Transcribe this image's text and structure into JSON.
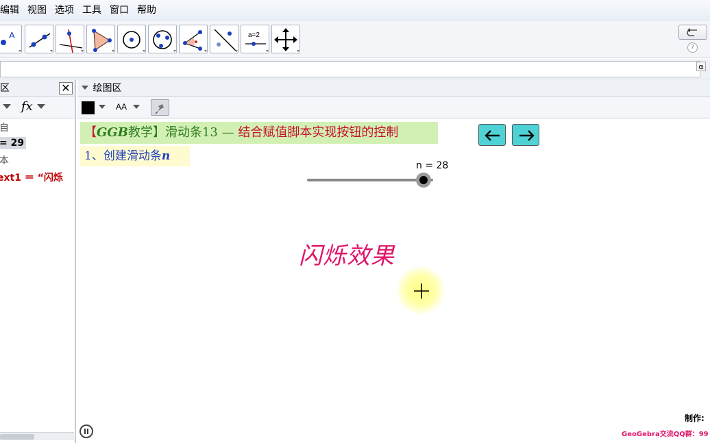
{
  "menu": [
    "编辑",
    "视图",
    "选项",
    "工具",
    "窗口",
    "帮助"
  ],
  "toolbar": {
    "tools": [
      {
        "name": "point-tool",
        "icon": "point-icon"
      },
      {
        "name": "line-tool",
        "icon": "line-icon"
      },
      {
        "name": "perpendicular-tool",
        "icon": "perpendicular-icon"
      },
      {
        "name": "polygon-tool",
        "icon": "polygon-icon"
      },
      {
        "name": "circle-tool",
        "icon": "circle-icon"
      },
      {
        "name": "conic-tool",
        "icon": "ellipse-icon"
      },
      {
        "name": "angle-tool",
        "icon": "angle-icon"
      },
      {
        "name": "reflect-tool",
        "icon": "reflect-icon"
      },
      {
        "name": "slider-tool",
        "icon": "slider-icon"
      },
      {
        "name": "move-view-tool",
        "icon": "move-graphics-icon"
      }
    ],
    "slider_tool_label": "a=2",
    "point_tool_label": "A",
    "help_label": "?"
  },
  "input_bar": {
    "value": "",
    "symbol_label": "α"
  },
  "algebra": {
    "title": "区",
    "close_label": "✕",
    "fx_label": "fx",
    "rows": [
      {
        "text": "自",
        "color": "#000000"
      },
      {
        "text": "= 29",
        "color": "#000000",
        "highlight": true
      },
      {
        "text": "本",
        "color": "#000000"
      },
      {
        "text": "ext1 ＝ “闪烁",
        "color": "#c00000"
      }
    ]
  },
  "graphics": {
    "title": "绘图区",
    "font_size_label": "AA",
    "title_box": {
      "prefix": "【",
      "brand": "GGB",
      "brand_suffix": "教学】",
      "subject": "滑动条13 ",
      "dash": "—",
      "topic": " 结合赋值脚本实现按钮的控制"
    },
    "step_label": "1、创建滑动条",
    "step_var": "n",
    "slider": {
      "label": "n = 28",
      "value": 28
    },
    "nav": {
      "prev": "←",
      "next": "→"
    },
    "flash_text": "闪烁效果",
    "maker_label": "制作:",
    "qq_label": "GeoGebra交流QQ群：99"
  },
  "colors": {
    "title_bg": "#d2f0b4",
    "title_red": "#c8102e",
    "title_green": "#2e7d20",
    "step_bg": "#fffbd0",
    "step_blue": "#1f3fbf",
    "flash": "#e0146a",
    "nav_bg": "#4fd2d6"
  }
}
